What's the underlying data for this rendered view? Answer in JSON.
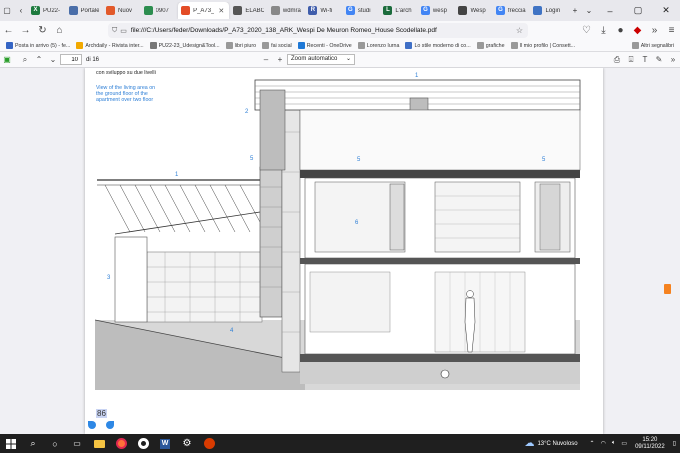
{
  "tabs": [
    {
      "label": "PU22-",
      "color": "#1d7a3e",
      "glyph": "X"
    },
    {
      "label": "Portale se",
      "color": "#4a6ea9",
      "glyph": ""
    },
    {
      "label": "Nuov",
      "color": "#e2592a",
      "glyph": ""
    },
    {
      "label": "0907",
      "color": "#2c8d4f",
      "glyph": ""
    },
    {
      "label": "P_A73_",
      "color": "#e34c26",
      "glyph": ""
    },
    {
      "label": "ELABORA",
      "color": "#555555",
      "glyph": ""
    },
    {
      "label": "wdmra.ch",
      "color": "#888888",
      "glyph": ""
    },
    {
      "label": "Wi-fi",
      "color": "#3f5dab",
      "glyph": "R"
    },
    {
      "label": "studi",
      "color": "#4285f4",
      "glyph": "G"
    },
    {
      "label": "L'arch",
      "color": "#1b6b3c",
      "glyph": "L"
    },
    {
      "label": "wesp",
      "color": "#4285f4",
      "glyph": "G"
    },
    {
      "label": "Wesp",
      "color": "#444444",
      "glyph": ""
    },
    {
      "label": "freccia",
      "color": "#4285f4",
      "glyph": "G"
    },
    {
      "label": "Login",
      "color": "#3f73c4",
      "glyph": ""
    }
  ],
  "nav": {
    "url": "file:///C:/Users/feder/Downloads/P_A73_2020_138_ARK_Wespi De Meuron Romeo_House Scodellate.pdf"
  },
  "bookmarks": [
    {
      "label": "Posta in arrivo (5) - fe...",
      "color": "#3565c4"
    },
    {
      "label": "Archdaily - Rivista inter...",
      "color": "#f2a900"
    },
    {
      "label": "PU22-23_Udesign&Tool...",
      "color": "#777777"
    },
    {
      "label": "libri piuro",
      "color": "#999999"
    },
    {
      "label": "fai social",
      "color": "#999999"
    },
    {
      "label": "Recenti - OneDrive",
      "color": "#1e78d6"
    },
    {
      "label": "Lorenzo Iurna",
      "color": "#999999"
    },
    {
      "label": "Lo stile moderno di co...",
      "color": "#3f6fc6"
    },
    {
      "label": "grafiche",
      "color": "#999999"
    },
    {
      "label": "Il mio profilo | Consett...",
      "color": "#999999"
    }
  ],
  "bookmarks_other": "Altri segnalibri",
  "pdf_toolbar": {
    "page": "10",
    "page_total": "di 16",
    "zoom": "Zoom automatico"
  },
  "pdf_content": {
    "caption_it": "con sviluppo su due livelli",
    "caption_en": "View of the living area on the ground floor of the apartment over two floor",
    "page_label": "86",
    "callouts": [
      "1",
      "2",
      "3",
      "4",
      "5",
      "5",
      "5",
      "6",
      "1"
    ]
  },
  "taskbar": {
    "weather": "13°C  Nuvoloso",
    "time": "15:20",
    "date": "09/11/2022"
  }
}
